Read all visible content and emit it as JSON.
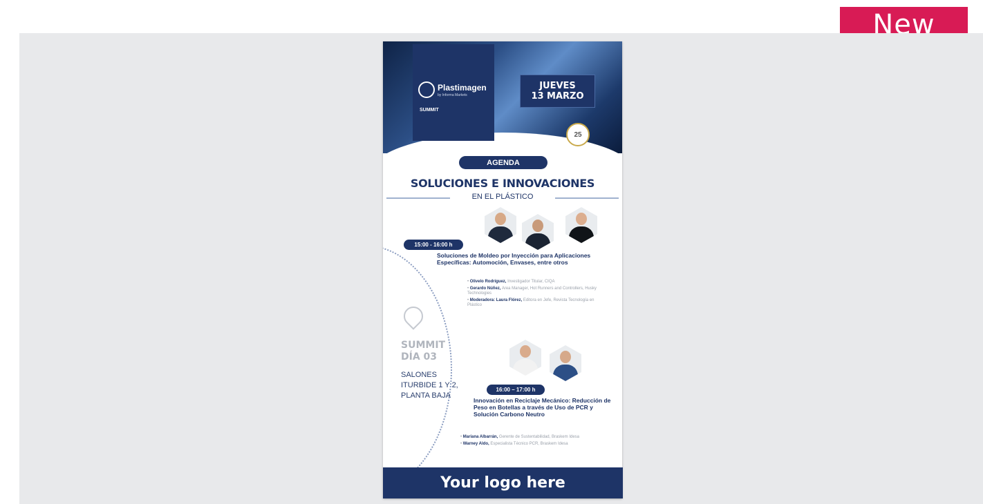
{
  "badge": {
    "label": "New"
  },
  "flyer": {
    "brand_name": "Plastimagen",
    "brand_sub": "by Informa Markets",
    "brand_summit": "SUMMIT",
    "date_line1": "JUEVES",
    "date_line2": "13 MARZO",
    "anniversary": "25",
    "agenda_label": "AGENDA",
    "title": "SOLUCIONES E INNOVACIONES",
    "subtitle": "EN EL PLÁSTICO",
    "side": {
      "summit_line1": "SUMMIT",
      "summit_line2": "DÍA 03",
      "venue_line1": "SALONES",
      "venue_line2": "ITURBIDE 1 Y 2,",
      "venue_line3": "PLANTA BAJA"
    },
    "sessions": [
      {
        "time": "15:00 - 16:00 h",
        "title": "Soluciones de Moldeo por Inyección para Aplicaciones Específicas: Automoción, Envases, entre otros",
        "speakers": [
          {
            "name": "Olivelo Rodríguez,",
            "role": "Investigador Titular, CIQA"
          },
          {
            "name": "Gerardo Núñez,",
            "role": "Area Manager, Hot Runners and Controllers, Husky Technologies"
          },
          {
            "name": "Moderadora: Laura Flórez,",
            "role": "Editora en Jefe, Revista Tecnología en Plástico"
          }
        ]
      },
      {
        "time": "16:00 – 17:00 h",
        "title": "Innovación en Reciclaje Mecánico: Reducción de Peso en Botellas a través de Uso de PCR y Solución Carbono Neutro",
        "speakers": [
          {
            "name": "Mariana Albarrán,",
            "role": "Gerente de Sustentabilidad, Braskem Idesa"
          },
          {
            "name": "Warney Aldo,",
            "role": "Especialista Técnico PCR, Braskem Idesa"
          }
        ]
      }
    ]
  },
  "logo_bar": {
    "label": "Your logo here"
  },
  "colors": {
    "brand_navy": "#1e3467",
    "badge_pink": "#d81b55",
    "panel_gray": "#e8e9eb"
  }
}
